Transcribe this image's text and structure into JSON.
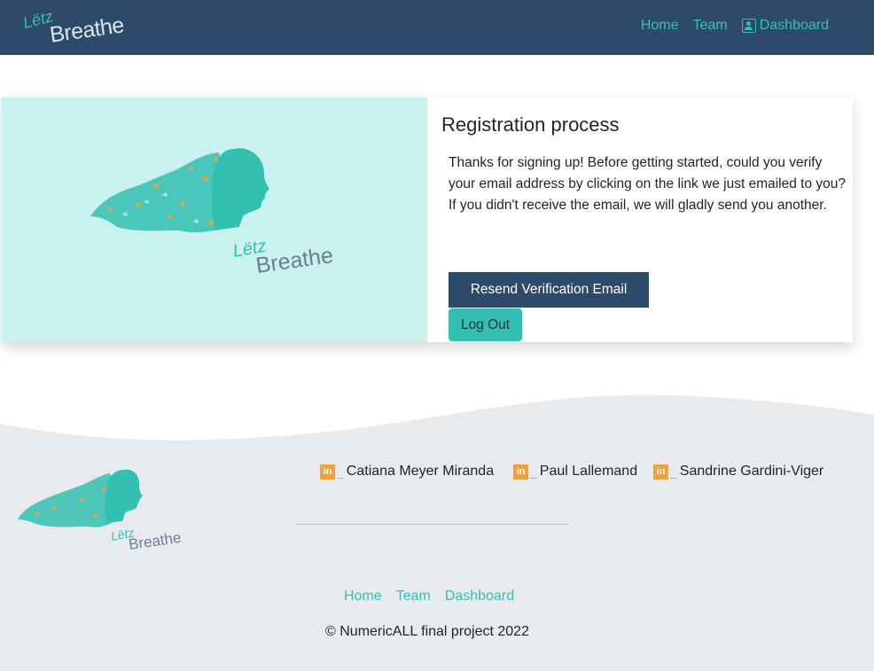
{
  "nav": {
    "brand_line1": "Lëtz",
    "brand_line2": "Breathe",
    "links": [
      "Home",
      "Team",
      "Dashboard"
    ]
  },
  "card": {
    "title": "Registration process",
    "text": "Thanks for signing up! Before getting started, could you verify your email address by clicking on the link we just emailed to you? If you didn't receive the email, we will gladly send you another.",
    "resend_label": "Resend Verification Email",
    "logout_label": "Log Out",
    "logo_line1": "Lëtz",
    "logo_line2": "Breathe"
  },
  "footer": {
    "team": [
      {
        "name": "Catiana Meyer Miranda",
        "icon": "linkedin-icon"
      },
      {
        "name": "Paul Lallemand",
        "icon": "linkedin-icon"
      },
      {
        "name": "Sandrine Gardini-Viger",
        "icon": "linkedin-icon"
      }
    ],
    "links": [
      "Home",
      "Team",
      "Dashboard"
    ],
    "copyright": "© NumericALL final project 2022",
    "logo_line1": "Lëtz",
    "logo_line2": "Breathe"
  },
  "colors": {
    "navy": "#2e4a6a",
    "teal": "#33c0b0",
    "light_teal": "#c9f1ee",
    "orange": "#f5a035",
    "footer_bg": "#e8ebee"
  }
}
